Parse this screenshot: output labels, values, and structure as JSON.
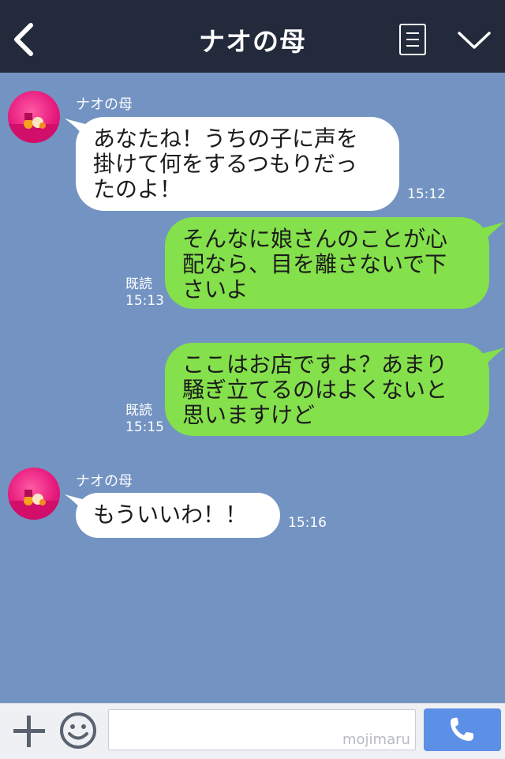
{
  "header": {
    "title": "ナオの母"
  },
  "messages": [
    {
      "sender": "ナオの母",
      "side": "left",
      "lines": [
        "あなたね！うちの子に声を",
        "掛けて何をするつもりだっ",
        "たのよ！"
      ],
      "time": "15:12"
    },
    {
      "side": "right",
      "lines": [
        "そんなに娘さんのことが心",
        "配なら、目を離さないで下",
        "さいよ"
      ],
      "read": "既読",
      "time": "15:13"
    },
    {
      "side": "right",
      "lines": [
        "ここはお店ですよ？あまり",
        "騒ぎ立てるのはよくないと",
        "思いますけど"
      ],
      "read": "既読",
      "time": "15:15"
    },
    {
      "sender": "ナオの母",
      "side": "left",
      "lines": [
        "もういいわ！！"
      ],
      "time": "15:16"
    }
  ],
  "input": {
    "value": "",
    "watermark": "mojimaru"
  },
  "colors": {
    "header_bg": "#232a3b",
    "chat_bg": "#7393c2",
    "bubble_left": "#ffffff",
    "bubble_right": "#84e04b",
    "send_button": "#5c8fe6"
  },
  "icons": {
    "back": "chevron-left-icon",
    "menu": "document-menu-icon",
    "collapse": "chevron-down-icon",
    "add": "plus-icon",
    "sticker": "smiley-icon",
    "send": "phone-icon",
    "avatar": "profile-avatar-icon"
  }
}
